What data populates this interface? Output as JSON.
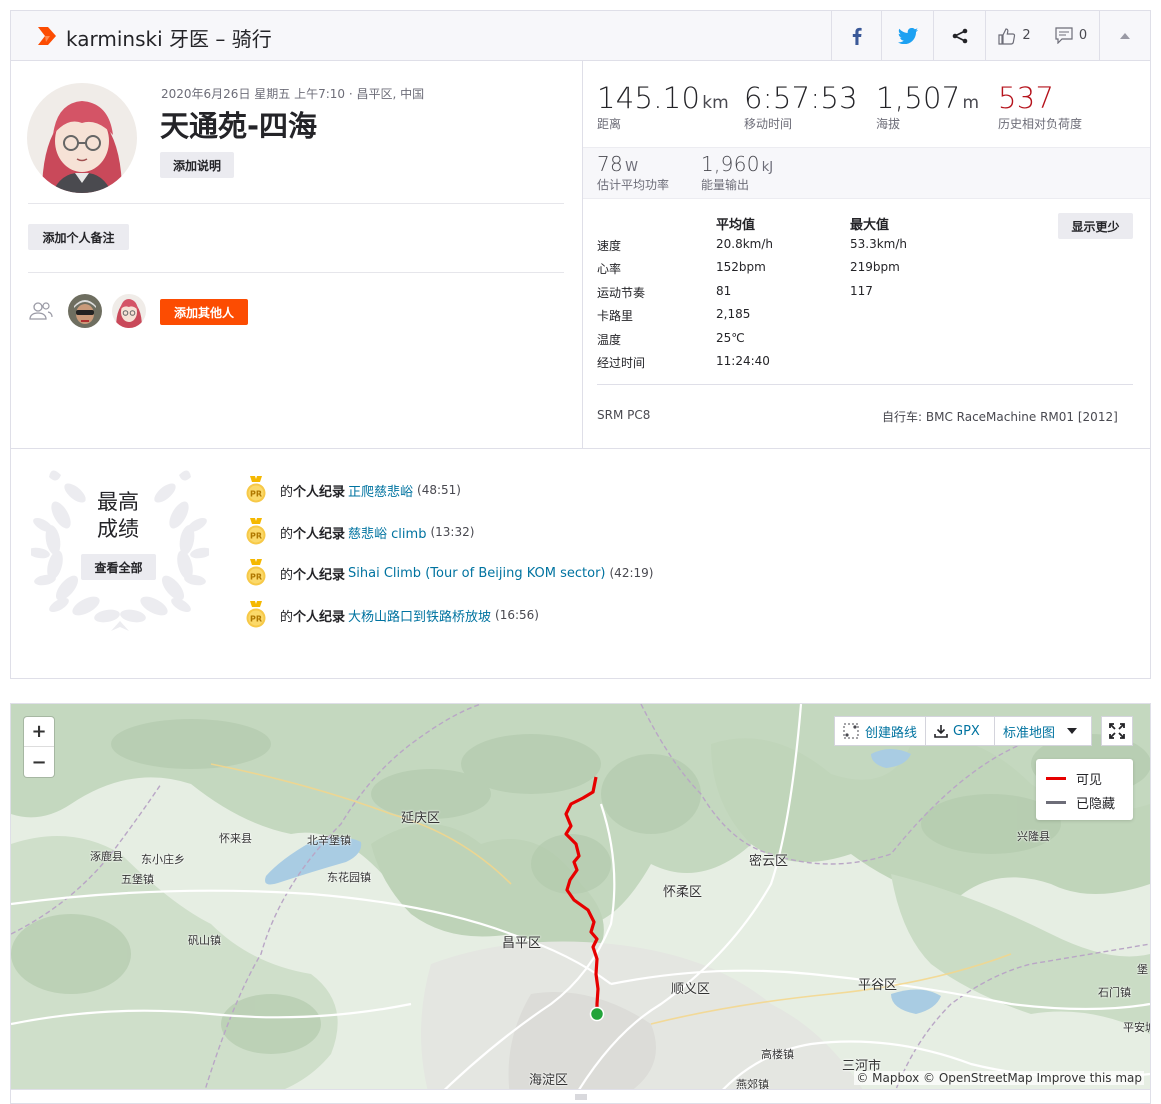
{
  "header": {
    "title": "karminski 牙医 – 骑行",
    "kudos_count": "2",
    "comments_count": "0",
    "icons": [
      "strava-logo-icon",
      "facebook-icon",
      "twitter-icon",
      "share-icon",
      "thumbs-up-icon",
      "comment-icon",
      "collapse-icon"
    ]
  },
  "activity": {
    "date_location": "2020年6月26日 星期五 上午7:10 · 昌平区, 中国",
    "name": "天通苑-四海",
    "add_description": "添加说明",
    "add_private_note": "添加个人备注",
    "add_others": "添加其他人"
  },
  "stats": {
    "primary": [
      {
        "value": "145.10",
        "unit": "km",
        "label": "距离"
      },
      {
        "value": "6:57:53",
        "unit": "",
        "label": "移动时间"
      },
      {
        "value": "1,507",
        "unit": "m",
        "label": "海拔"
      },
      {
        "value": "537",
        "unit": "",
        "label": "历史相对负荷度"
      }
    ],
    "secondary": [
      {
        "value": "78",
        "unit": "W",
        "label": "估计平均功率"
      },
      {
        "value": "1,960",
        "unit": "kJ",
        "label": "能量输出"
      }
    ],
    "table": {
      "header_avg": "平均值",
      "header_max": "最大值",
      "show_less": "显示更少",
      "rows": [
        {
          "label": "速度",
          "avg": "20.8km/h",
          "max": "53.3km/h"
        },
        {
          "label": "心率",
          "avg": "152bpm",
          "max": "219bpm"
        },
        {
          "label": "运动节奏",
          "avg": "81",
          "max": "117"
        },
        {
          "label": "卡路里",
          "avg": "2,185",
          "max": ""
        },
        {
          "label": "温度",
          "avg": "25℃",
          "max": ""
        },
        {
          "label": "经过时间",
          "avg": "11:24:40",
          "max": ""
        }
      ]
    },
    "device": "SRM PC8",
    "bike": "自行车: BMC RaceMachine RM01 [2012]"
  },
  "achievements": {
    "title_line1": "最高",
    "title_line2": "成绩",
    "view_all": "查看全部",
    "medal_text": "PR",
    "items": [
      {
        "prefix": "的",
        "label": "个人纪录",
        "segment": "正爬慈悲峪",
        "time": "(48:51)"
      },
      {
        "prefix": "的",
        "label": "个人纪录",
        "segment": "慈悲峪 climb",
        "time": "(13:32)"
      },
      {
        "prefix": "的",
        "label": "个人纪录",
        "segment": "Sihai Climb (Tour of Beijing KOM sector)",
        "time": "(42:19)"
      },
      {
        "prefix": "的",
        "label": "个人纪录",
        "segment": "大杨山路口到铁路桥放坡",
        "time": "(16:56)"
      }
    ]
  },
  "map": {
    "zoom_in": "+",
    "zoom_out": "−",
    "create_route": "创建路线",
    "gpx": "GPX",
    "map_style": "标准地图",
    "legend_visible": "可见",
    "legend_hidden": "已隐藏",
    "attribution": "© Mapbox © OpenStreetMap Improve this map",
    "route_color": "#e60000",
    "labels": [
      {
        "text": "延庆区"
      },
      {
        "text": "怀来县"
      },
      {
        "text": "北辛堡镇"
      },
      {
        "text": "涿鹿县"
      },
      {
        "text": "东小庄乡"
      },
      {
        "text": "五堡镇"
      },
      {
        "text": "东花园镇"
      },
      {
        "text": "矾山镇"
      },
      {
        "text": "昌平区"
      },
      {
        "text": "怀柔区"
      },
      {
        "text": "密云区"
      },
      {
        "text": "兴隆县"
      },
      {
        "text": "顺义区"
      },
      {
        "text": "平谷区"
      },
      {
        "text": "石门镇"
      },
      {
        "text": "平安城"
      },
      {
        "text": "高楼镇"
      },
      {
        "text": "三河市"
      },
      {
        "text": "燕郊镇"
      },
      {
        "text": "海淀区"
      },
      {
        "text": "堡"
      }
    ]
  }
}
